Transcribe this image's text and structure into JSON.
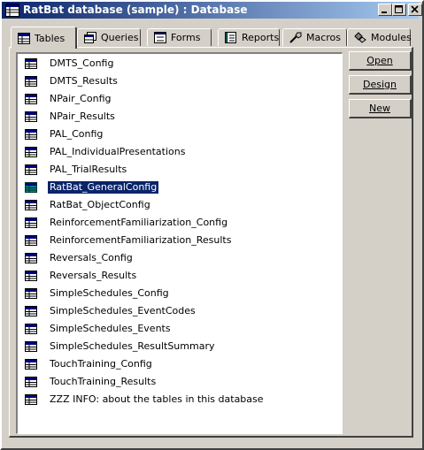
{
  "window": {
    "title": "RatBat database (sample) : Database"
  },
  "titlebar_buttons": [
    "minimize",
    "maximize",
    "close"
  ],
  "tabs": [
    {
      "label": "Tables",
      "icon": "table-icon",
      "active": true
    },
    {
      "label": "Queries",
      "icon": "query-icon"
    },
    {
      "label": "Forms",
      "icon": "form-icon"
    },
    {
      "label": "Reports",
      "icon": "report-icon"
    },
    {
      "label": "Macros",
      "icon": "macro-icon"
    },
    {
      "label": "Modules",
      "icon": "module-icon"
    }
  ],
  "tables": [
    "DMTS_Config",
    "DMTS_Results",
    "NPair_Config",
    "NPair_Results",
    "PAL_Config",
    "PAL_IndividualPresentations",
    "PAL_TrialResults",
    "RatBat_GeneralConfig",
    "RatBat_ObjectConfig",
    "ReinforcementFamiliarization_Config",
    "ReinforcementFamiliarization_Results",
    "Reversals_Config",
    "Reversals_Results",
    "SimpleSchedules_Config",
    "SimpleSchedules_EventCodes",
    "SimpleSchedules_Events",
    "SimpleSchedules_ResultSummary",
    "TouchTraining_Config",
    "TouchTraining_Results",
    "ZZZ INFO: about the tables in this database"
  ],
  "selected_table": "RatBat_GeneralConfig",
  "buttons": {
    "open": "Open",
    "design": "Design",
    "new": "New"
  },
  "colors": {
    "titlebar_start": "#0a246a",
    "titlebar_end": "#a6caf0",
    "selection": "#0a246a",
    "face": "#d4d0c8"
  }
}
